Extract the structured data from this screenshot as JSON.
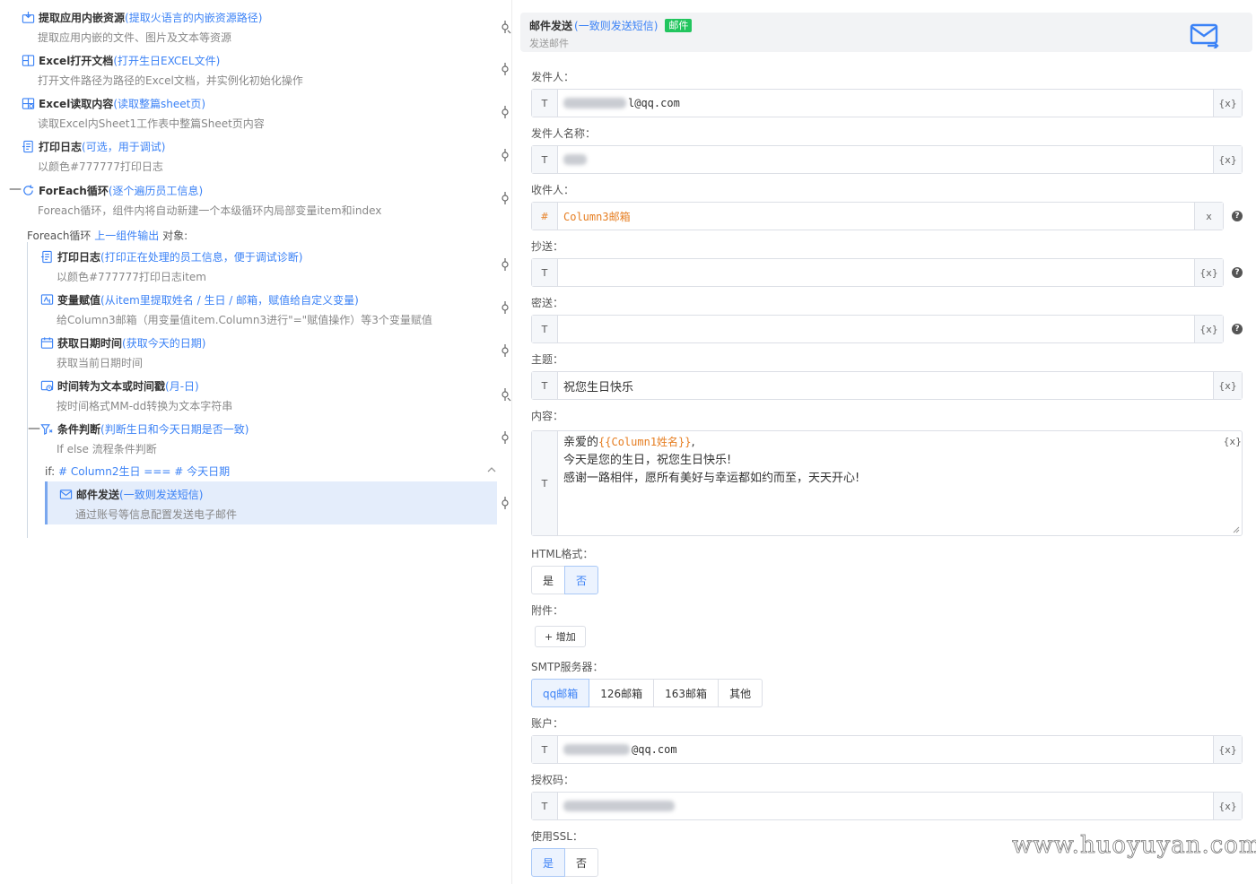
{
  "left": {
    "steps": [
      {
        "title": "提取应用内嵌资源",
        "hint": "(提取火语言的内嵌资源路径)",
        "desc": "提取应用内嵌的文件、图片及文本等资源",
        "icon": "extract-resource-icon"
      },
      {
        "title": "Excel打开文档",
        "hint": "(打开生日EXCEL文件)",
        "desc": "打开文件路径为路径的Excel文档，并实例化初始化操作",
        "icon": "excel-open-icon"
      },
      {
        "title": "Excel读取内容",
        "hint": "(读取整篇sheet页)",
        "desc": "读取Excel内Sheet1工作表中整篇Sheet页内容",
        "icon": "excel-read-icon"
      },
      {
        "title": "打印日志",
        "hint": "(可选，用于调试)",
        "desc": "以颜色#777777打印日志",
        "icon": "print-log-icon"
      },
      {
        "title": "ForEach循环",
        "hint": " (逐个遍历员工信息)",
        "desc": "Foreach循环，组件内将自动新建一个本级循环内局部变量item和index",
        "icon": "loop-icon"
      },
      {
        "title": "打印日志",
        "hint": "(打印正在处理的员工信息，便于调试诊断)",
        "desc": "以颜色#777777打印日志item",
        "icon": "print-log-icon"
      },
      {
        "title": "变量赋值",
        "hint": "(从item里提取姓名 / 生日 / 邮箱，赋值给自定义变量)",
        "desc": "给Column3邮箱（用变量值item.Column3进行\"=\"赋值操作）等3个变量赋值",
        "icon": "assign-variable-icon"
      },
      {
        "title": "获取日期时间",
        "hint": "(获取今天的日期)",
        "desc": "获取当前日期时间",
        "icon": "calendar-icon"
      },
      {
        "title": "时间转为文本或时间戳",
        "hint": "(月-日)",
        "desc": "按时间格式MM-dd转换为文本字符串",
        "icon": "time-convert-icon"
      },
      {
        "title": "条件判断",
        "hint": "(判断生日和今天日期是否一致)",
        "desc": "If else 流程条件判断",
        "icon": "condition-icon"
      },
      {
        "title": "邮件发送",
        "hint": "(一致则发送短信)",
        "desc": "通过账号等信息配置发送电子邮件",
        "icon": "mail-send-icon"
      }
    ],
    "foreach_line": {
      "prefix": "Foreach循环 ",
      "link": "上一组件输出",
      "suffix": " 对象:"
    },
    "if_line": {
      "prefix": "if:  ",
      "cond": "# Column2生日 === # 今天日期"
    }
  },
  "panel": {
    "header": {
      "title": "邮件发送",
      "hint": "(一致则发送短信)",
      "badge": "邮件",
      "subtitle": "发送邮件",
      "icon": "mail-send-icon"
    },
    "labels": {
      "sender": "发件人：",
      "sender_name": "发件人名称：",
      "recipient": "收件人：",
      "cc": "抄送：",
      "bcc": "密送：",
      "subject": "主题：",
      "content": "内容：",
      "html": "HTML格式：",
      "attachment": "附件：",
      "smtp": "SMTP服务器：",
      "account": "账户：",
      "auth": "授权码：",
      "ssl": "使用SSL："
    },
    "prefix_text": "T",
    "prefix_hash": "#",
    "var_suffix": "{x}",
    "clear_suffix": "x",
    "help_mark": "?",
    "sender_value": "l@qq.com",
    "recipient_value": "Column3邮箱",
    "subject_value": "祝您生日快乐",
    "content": {
      "line1_prefix": "亲爱的",
      "line1_var": "{{Column1姓名}}",
      "line1_suffix": ",",
      "line2": "今天是您的生日，祝您生日快乐!",
      "line3": "感谢一路相伴，愿所有美好与幸运都如约而至，天天开心!"
    },
    "yes": "是",
    "no": "否",
    "html_selected": "否",
    "add_button": "+ 增加",
    "smtp_options": [
      "qq邮箱",
      "126邮箱",
      "163邮箱",
      "其他"
    ],
    "smtp_selected": "qq邮箱",
    "account_value": "@qq.com",
    "ssl_selected": "是"
  },
  "watermark": "www.huoyuyan.com"
}
